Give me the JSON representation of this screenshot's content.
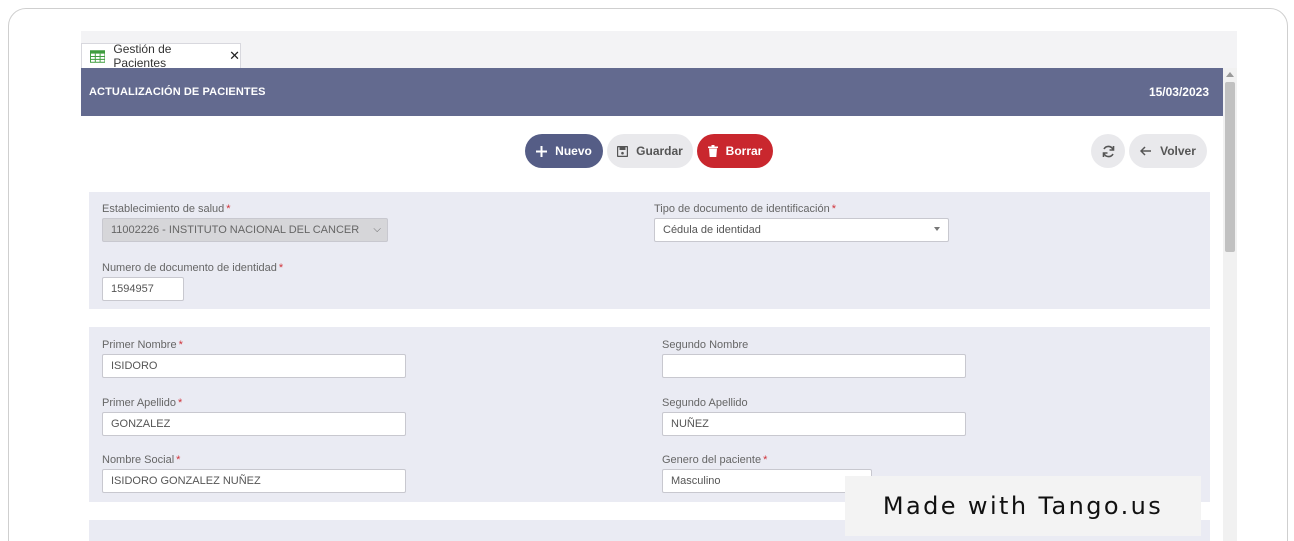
{
  "tab": {
    "label": "Gestión de Pacientes",
    "close": "✕",
    "icon": "table-icon"
  },
  "header": {
    "title": "ACTUALIZACIÓN DE PACIENTES",
    "date": "15/03/2023"
  },
  "toolbar": {
    "nuevo_label": "Nuevo",
    "guardar_label": "Guardar",
    "borrar_label": "Borrar",
    "volver_label": "Volver",
    "refresh_icon": "refresh-icon"
  },
  "form1": {
    "establecimiento": {
      "label": "Establecimiento de salud",
      "value": "11002226 - INSTITUTO NACIONAL DEL CANCER"
    },
    "tipo_documento": {
      "label": "Tipo de documento de identificación",
      "value": "Cédula de identidad"
    },
    "numero_documento": {
      "label": "Numero de documento de identidad",
      "value": "1594957"
    }
  },
  "form2": {
    "primer_nombre": {
      "label": "Primer Nombre",
      "value": "ISIDORO"
    },
    "segundo_nombre": {
      "label": "Segundo Nombre",
      "value": ""
    },
    "primer_apellido": {
      "label": "Primer Apellido",
      "value": "GONZALEZ"
    },
    "segundo_apellido": {
      "label": "Segundo Apellido",
      "value": "NUÑEZ"
    },
    "nombre_social": {
      "label": "Nombre Social",
      "value": "ISIDORO GONZALEZ NUÑEZ"
    },
    "genero": {
      "label": "Genero del paciente",
      "value": "Masculino"
    }
  },
  "required_marker": "*",
  "watermark": "Made with Tango.us",
  "colors": {
    "header_bg": "#636a8f",
    "nuevo_bg": "#555d86",
    "borrar_bg": "#c9272e",
    "panel_bg": "#eaebf3",
    "required": "#d0333a"
  }
}
